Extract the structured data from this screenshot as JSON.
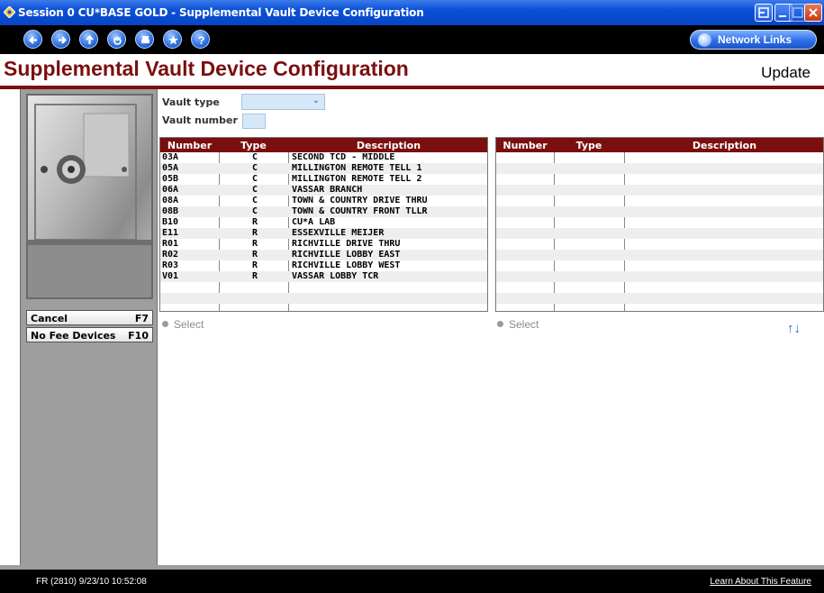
{
  "window": {
    "title": "Session 0 CU*BASE GOLD - Supplemental Vault Device Configuration"
  },
  "toolbar": {
    "network_links": "Network Links"
  },
  "header": {
    "title": "Supplemental Vault Device Configuration",
    "mode": "Update"
  },
  "sidebar": {
    "fkeys": [
      {
        "label": "Cancel",
        "key": "F7"
      },
      {
        "label": "No Fee Devices",
        "key": "F10"
      }
    ]
  },
  "filters": {
    "vault_type_label": "Vault type",
    "vault_type_value": "",
    "vault_number_label": "Vault number",
    "vault_number_value": ""
  },
  "left_table": {
    "columns": [
      "Number",
      "Type",
      "Description"
    ],
    "rows": [
      [
        "03A",
        "C",
        "SECOND TCD - MIDDLE"
      ],
      [
        "05A",
        "C",
        "MILLINGTON REMOTE TELL 1"
      ],
      [
        "05B",
        "C",
        "MILLINGTON REMOTE TELL 2"
      ],
      [
        "06A",
        "C",
        "VASSAR BRANCH"
      ],
      [
        "08A",
        "C",
        "TOWN & COUNTRY DRIVE THRU"
      ],
      [
        "08B",
        "C",
        "TOWN & COUNTRY FRONT TLLR"
      ],
      [
        "B10",
        "R",
        "CU*A LAB"
      ],
      [
        "E11",
        "R",
        "ESSEXVILLE MEIJER"
      ],
      [
        "R01",
        "R",
        "RICHVILLE DRIVE THRU"
      ],
      [
        "R02",
        "R",
        "RICHVILLE LOBBY EAST"
      ],
      [
        "R03",
        "R",
        "RICHVILLE LOBBY WEST"
      ],
      [
        "V01",
        "R",
        "VASSAR LOBBY TCR"
      ]
    ],
    "select_label": "Select"
  },
  "right_table": {
    "columns": [
      "Number",
      "Type",
      "Description"
    ],
    "rows": [],
    "select_label": "Select"
  },
  "status": {
    "left": "FR (2810) 9/23/10 10:52:08",
    "right": "Learn About This Feature"
  }
}
